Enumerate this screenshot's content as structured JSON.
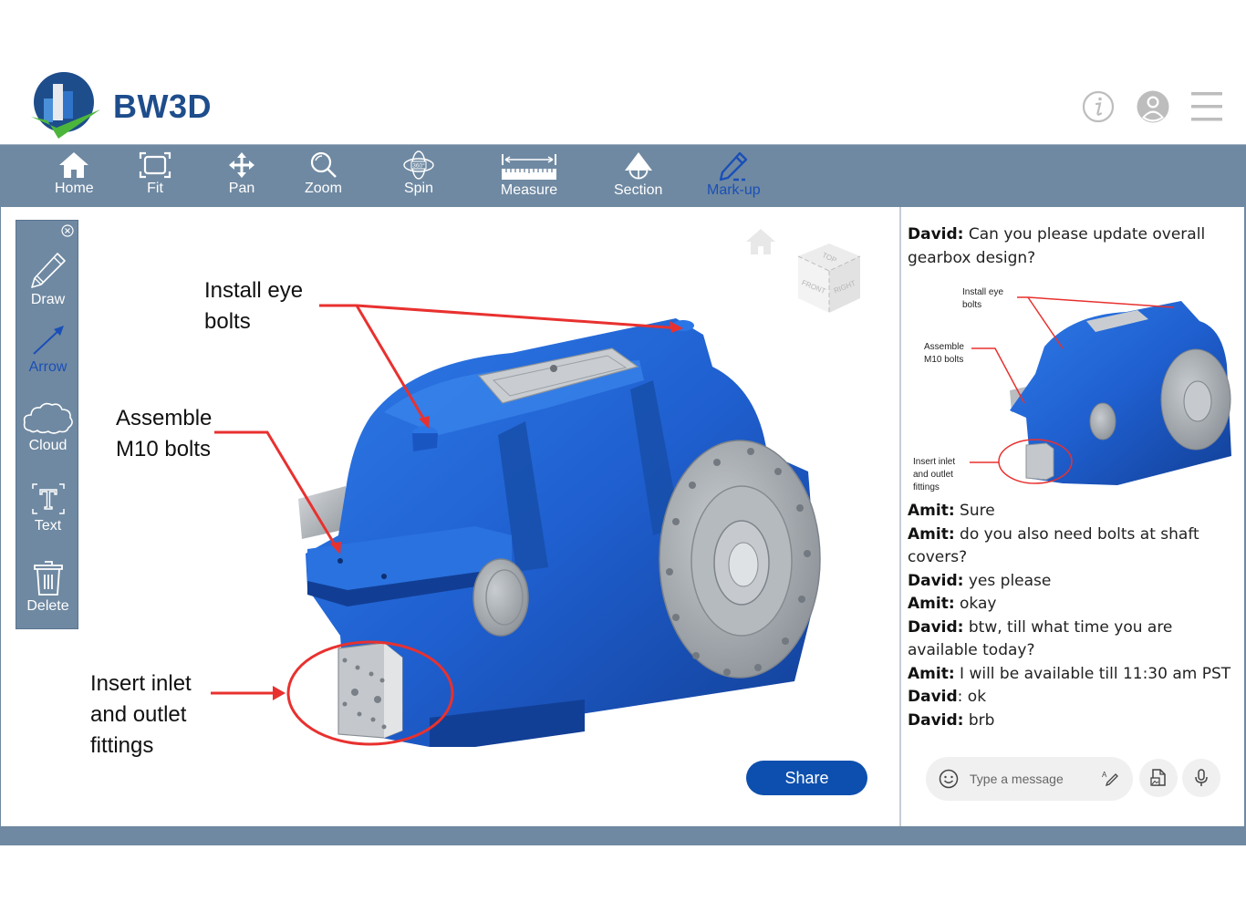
{
  "app": {
    "brand": "BW3D"
  },
  "header": {
    "icons": [
      "info-icon",
      "user-avatar-icon",
      "hamburger-menu-icon"
    ]
  },
  "toolbar": {
    "items": [
      {
        "label": "Home",
        "icon": "home-icon"
      },
      {
        "label": "Fit",
        "icon": "fit-icon"
      },
      {
        "label": "Pan",
        "icon": "pan-icon"
      },
      {
        "label": "Zoom",
        "icon": "zoom-icon"
      },
      {
        "label": "Spin",
        "icon": "spin-360-icon"
      },
      {
        "label": "Measure",
        "icon": "measure-icon"
      },
      {
        "label": "Section",
        "icon": "section-icon"
      },
      {
        "label": "Mark-up",
        "icon": "markup-pencil-icon",
        "active": true
      }
    ]
  },
  "markup_panel": {
    "items": [
      {
        "label": "Draw",
        "icon": "pencil-icon"
      },
      {
        "label": "Arrow",
        "icon": "arrow-icon",
        "active": true
      },
      {
        "label": "Cloud",
        "icon": "cloud-icon"
      },
      {
        "label": "Text",
        "icon": "text-icon"
      },
      {
        "label": "Delete",
        "icon": "trash-icon"
      }
    ]
  },
  "viewer": {
    "annotations": [
      {
        "line1": "Install eye",
        "line2": "bolts"
      },
      {
        "line1": "Assemble",
        "line2": "M10 bolts"
      },
      {
        "line1": "Insert inlet",
        "line2": "and outlet",
        "line3": "fittings"
      }
    ],
    "view_cube": {
      "top": "TOP",
      "front": "FRONT",
      "right": "RIGHT"
    },
    "share_label": "Share"
  },
  "chat": {
    "messages": [
      {
        "author": "David:",
        "text": " Can you please update overall gearbox design?"
      },
      {
        "author": "Amit:",
        "text": " Sure"
      },
      {
        "author": "Amit:",
        "text": " do you also need bolts at shaft covers?"
      },
      {
        "author": "David:",
        "text": " yes please"
      },
      {
        "author": "Amit:",
        "text": " okay"
      },
      {
        "author": "David:",
        "text": " btw, till what time you are available today?"
      },
      {
        "author": "Amit:",
        "text": " I will be available till 11:30 am PST"
      },
      {
        "author": "David",
        "text": ": ok"
      },
      {
        "author": "David:",
        "text": " brb"
      }
    ],
    "attachment_labels": {
      "a": "Install eye bolts",
      "b": "Assemble M10 bolts",
      "c": "Insert inlet and outlet fittings"
    },
    "compose_placeholder": "Type a message"
  },
  "colors": {
    "toolbar_bg": "#6f89a2",
    "active_blue": "#1a4fb8",
    "share_blue": "#0d4fae",
    "annotation_red": "#e8312f",
    "gearbox_blue": "#1f5fcf",
    "brand_navy": "#1e4d8c",
    "check_green": "#4cb63c"
  }
}
